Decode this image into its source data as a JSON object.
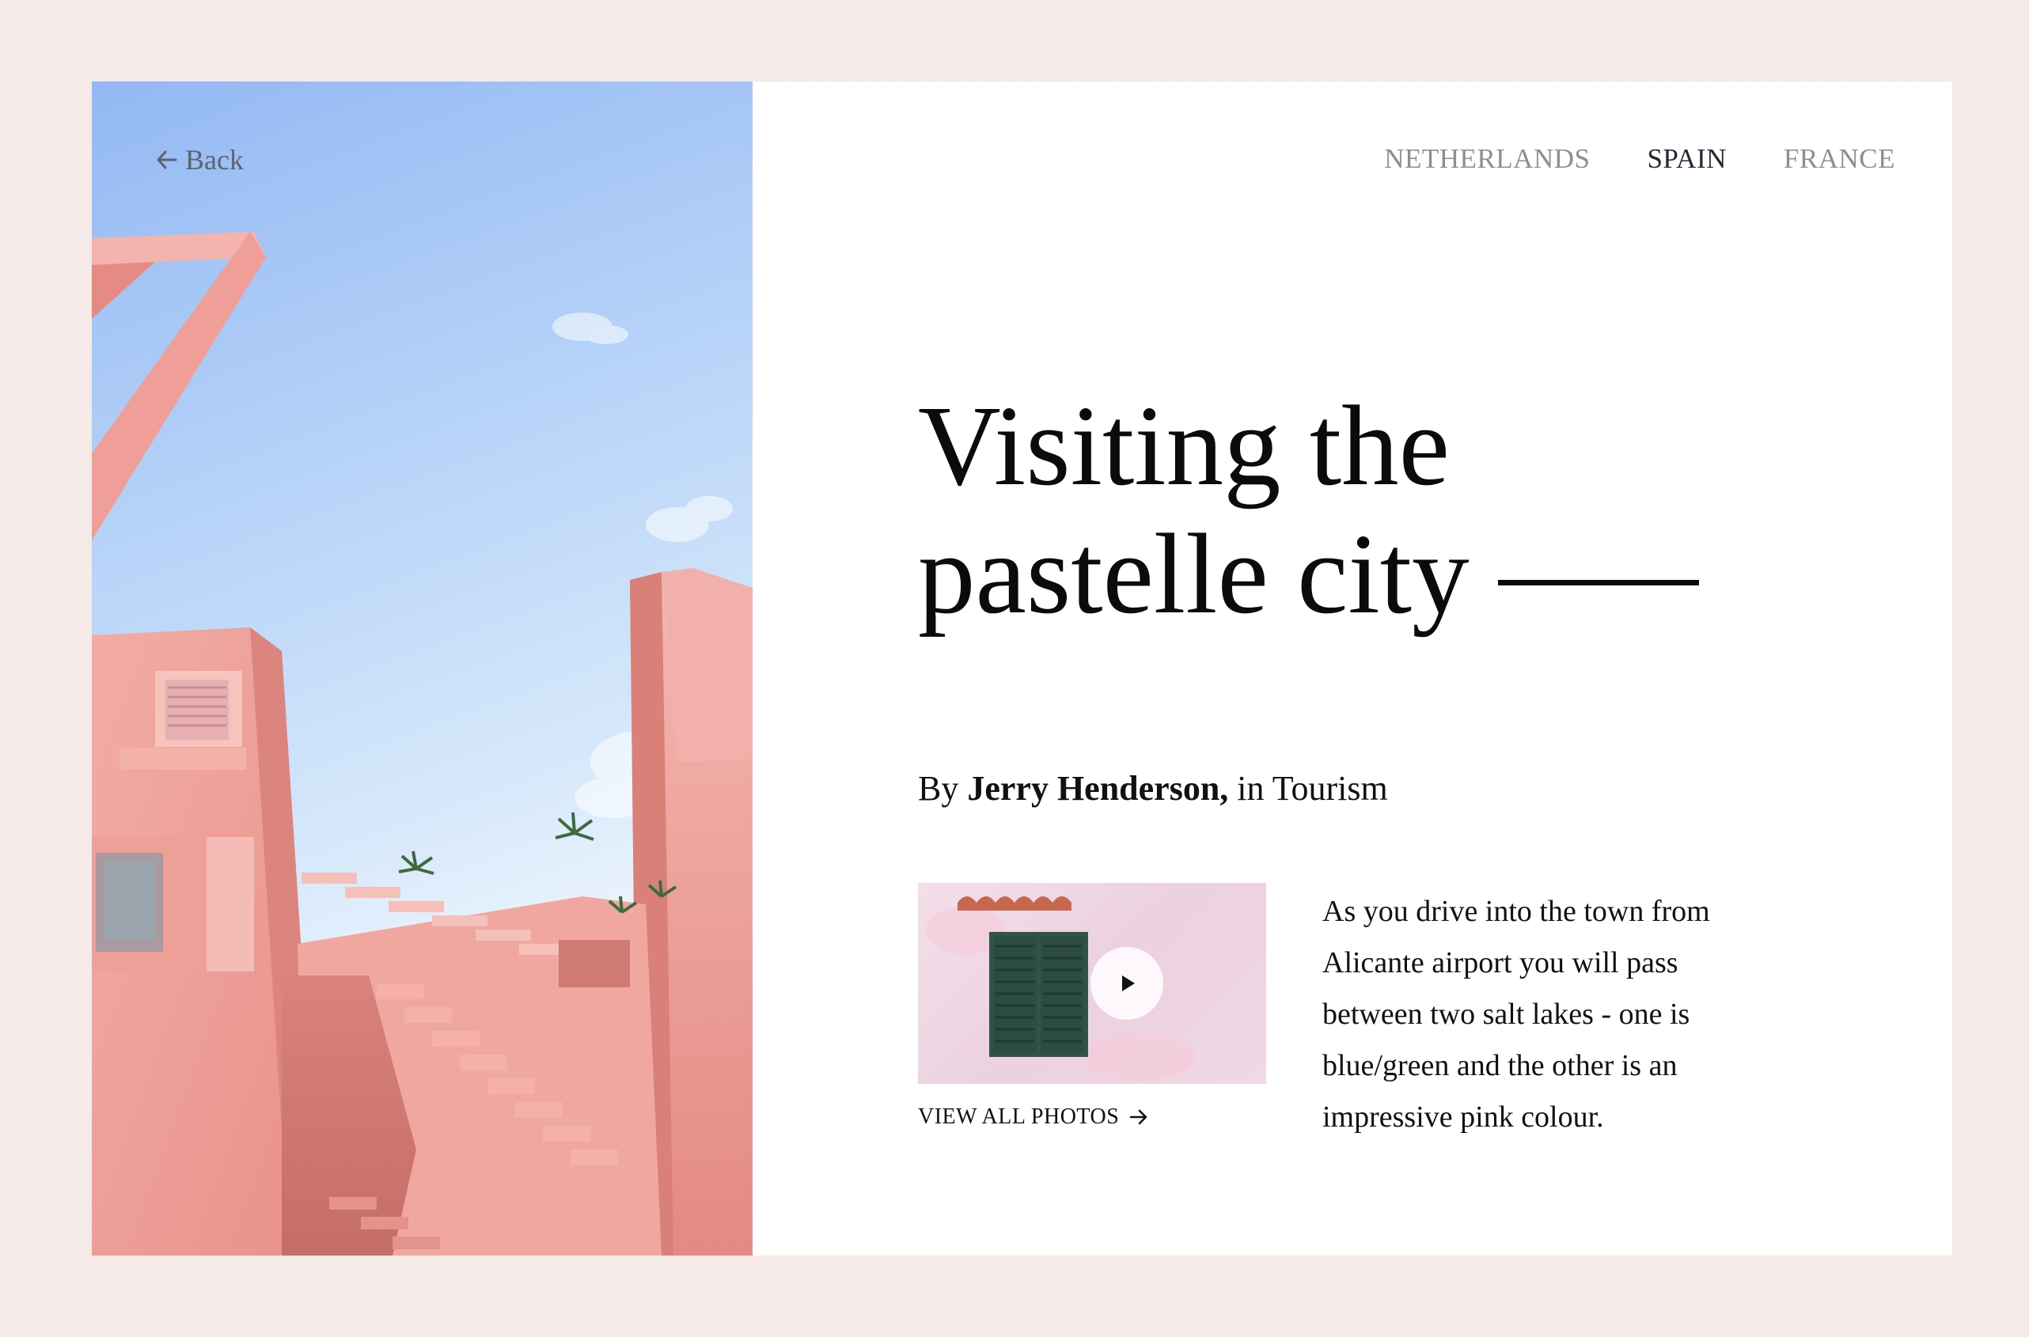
{
  "back": {
    "label": "Back"
  },
  "nav": {
    "items": [
      "NETHERLANDS",
      "SPAIN",
      "FRANCE"
    ],
    "active": "SPAIN"
  },
  "article": {
    "title_line1": "Visiting the",
    "title_line2": "pastelle city",
    "byline_prefix": "By",
    "author": "Jerry Henderson,",
    "category_text": "in Tourism",
    "description": "As you drive into the town from Alicante airport you will pass between two salt lakes - one is blue/green and the other is an impressive pink colour."
  },
  "media": {
    "view_all_label": "VIEW ALL PHOTOS"
  },
  "icons": {
    "back": "arrow-left-icon",
    "play": "play-icon",
    "view_all": "arrow-right-icon"
  },
  "colors": {
    "page_bg": "#f6eae8",
    "card_bg": "#ffffff",
    "text": "#0b0b0b",
    "nav_inactive": "#8a8f96",
    "nav_active": "#1f2a36",
    "building_pink": "#eda09a",
    "sky_blue": "#a8c8f5"
  }
}
